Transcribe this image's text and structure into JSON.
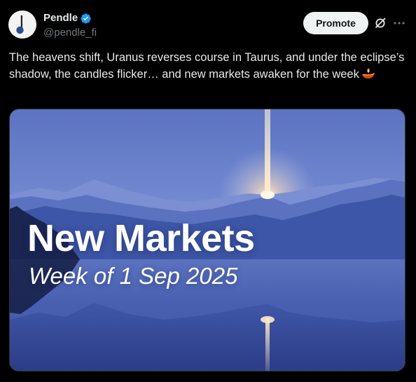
{
  "author": {
    "display_name": "Pendle",
    "handle": "@pendle_fi",
    "verified": true,
    "verified_color": "#1d9bf0"
  },
  "actions": {
    "promote_label": "Promote",
    "grok_icon": "grok-icon",
    "more_icon": "more-dots-icon"
  },
  "post": {
    "text": "The heavens shift, Uranus reverses course in Taurus, and under the eclipse’s shadow, the candles flicker… and new markets awaken for the week",
    "trailing_icon": "oil-lamp-icon"
  },
  "media": {
    "headline": "New Markets",
    "subline": "Week of 1 Sep 2025"
  },
  "colors": {
    "background": "#000000",
    "text_primary": "#e7e9ea",
    "text_secondary": "#71767b",
    "promote_bg": "#eff3f4"
  }
}
